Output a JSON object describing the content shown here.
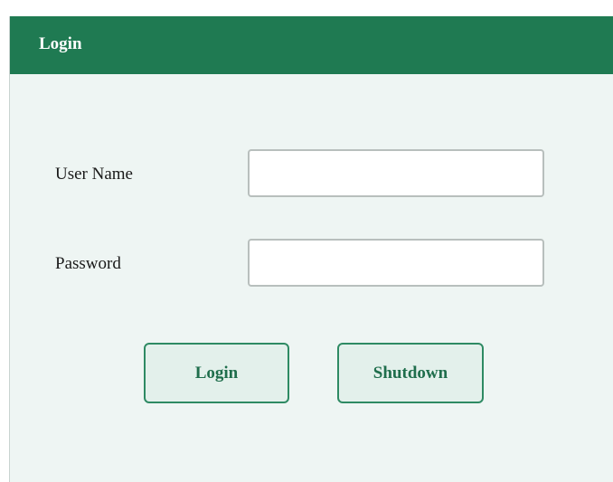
{
  "window": {
    "title": "Login"
  },
  "form": {
    "username_label": "User Name",
    "username_value": "",
    "password_label": "Password",
    "password_value": ""
  },
  "buttons": {
    "login_label": "Login",
    "shutdown_label": "Shutdown"
  },
  "colors": {
    "title_bar": "#1f7a52",
    "background": "#eef5f3",
    "button_text": "#1f6e4c",
    "button_border": "#2e8a63"
  }
}
